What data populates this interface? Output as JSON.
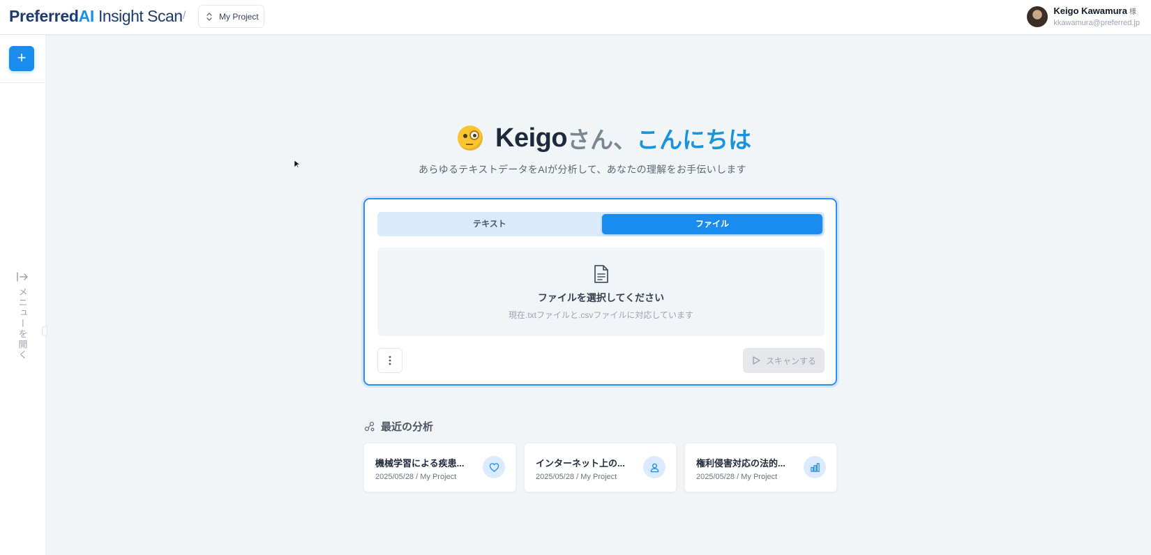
{
  "header": {
    "logo": {
      "brand_a": "Preferred",
      "brand_b": "AI",
      "product": "Insight Scan"
    },
    "breadcrumb_sep": "/",
    "project": "My Project",
    "user": {
      "name": "Keigo Kawamura",
      "honorific": "様",
      "email": "kkawamura@preferred.jp"
    }
  },
  "sidebar": {
    "new_label": "+",
    "open_menu_label": "メニューを開く"
  },
  "greeting": {
    "name": "Keigo",
    "san": "さん、",
    "hello": "こんにちは",
    "subtitle": "あらゆるテキストデータをAIが分析して、あなたの理解をお手伝いします"
  },
  "input_card": {
    "tabs": [
      {
        "label": "テキスト",
        "active": false
      },
      {
        "label": "ファイル",
        "active": true
      }
    ],
    "dropzone_title": "ファイルを選択してください",
    "dropzone_hint": "現在.txtファイルと.csvファイルに対応しています",
    "scan_label": "スキャンする"
  },
  "recent": {
    "title": "最近の分析",
    "items": [
      {
        "title": "機械学習による疾患...",
        "date": "2025/05/28",
        "sep": "/",
        "project": "My Project",
        "icon": "heart-icon"
      },
      {
        "title": "インターネット上の...",
        "date": "2025/05/28",
        "sep": "/",
        "project": "My Project",
        "icon": "user-icon"
      },
      {
        "title": "権利侵害対応の法的...",
        "date": "2025/05/28",
        "sep": "/",
        "project": "My Project",
        "icon": "chart-icon"
      }
    ]
  },
  "colors": {
    "accent": "#1a8cf0",
    "greeting_blue": "#1a93dd",
    "background": "#f2f5f7"
  }
}
